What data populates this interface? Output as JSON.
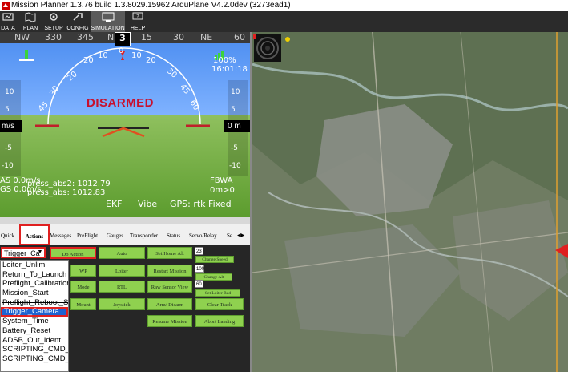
{
  "window": {
    "title": "Mission Planner 1.3.76 build 1.3.8029.15962 ArduPlane V4.2.0dev (3273ead1)"
  },
  "menubar": [
    {
      "label": "DATA",
      "icon": "data-icon"
    },
    {
      "label": "PLAN",
      "icon": "plan-icon"
    },
    {
      "label": "SETUP",
      "icon": "setup-icon"
    },
    {
      "label": "CONFIG",
      "icon": "config-icon"
    },
    {
      "label": "SIMULATION",
      "icon": "simulation-icon"
    },
    {
      "label": "HELP",
      "icon": "help-icon"
    }
  ],
  "hud": {
    "compass": [
      "NW",
      "330",
      "345",
      "N",
      "3",
      "15",
      "30",
      "NE",
      "60"
    ],
    "heading": "3",
    "roll_scale": [
      "20",
      "10",
      "0",
      "10",
      "20",
      "30",
      "30",
      "45",
      "45",
      "60",
      "60"
    ],
    "status": "DISARMED",
    "battery_percent": "100%",
    "clock": "16:01:18",
    "speed_readout": "m/s",
    "alt_readout": "0 m",
    "left_tape": [
      "10",
      "5",
      "0",
      "-5",
      "-10"
    ],
    "right_tape": [
      "10",
      "5",
      "0",
      "-5",
      "-10"
    ],
    "as_line": "AS 0.0m/s",
    "gs_line": "GS 0.0m/s",
    "press_abs2": "press_abs2: 1012.79",
    "press_abs": "press_abs: 1012.83",
    "mode": "FBWA",
    "alt_line": "0m>0",
    "ekf": "EKF",
    "vibe": "Vibe",
    "gps": "GPS: rtk Fixed"
  },
  "tabs": [
    "Quick",
    "Actions",
    "Messages",
    "PreFlight",
    "Gauges",
    "Transponder",
    "Status",
    "Servo/Relay",
    "Se"
  ],
  "actions": {
    "combo_value": "Trigger_Ca",
    "buttons": {
      "do_action": "Do Action",
      "auto": "Auto",
      "set_home_alt": "Set Home Alt",
      "wp": "WP",
      "loiter": "Loiter",
      "restart_mission": "Restart Mission",
      "mode": "Mode",
      "rtl": "RTL",
      "raw_sensor_view": "Raw Sensor View",
      "mount": "Mount",
      "joystick": "Joystick",
      "arm_disarm": "Arm/ Disarm",
      "clear_track": "Clear Track",
      "resume_mission": "Resume Mission",
      "abort_landing": "Abort Landing",
      "change_speed": "Change Speed",
      "change_alt": "Change Alt",
      "set_loiter_rad": "Set Loiter Rad"
    },
    "num_speed": "23",
    "num_alt": "100",
    "num_rad": "60"
  },
  "dropdown": [
    "Loiter_Unlim",
    "Return_To_Launch",
    "Preflight_Calibration",
    "Mission_Start",
    "Preflight_Reboot_Sh",
    "Trigger_Camera",
    "System_Time",
    "Battery_Reset",
    "ADSB_Out_Ident",
    "SCRIPTING_CMD_S",
    "SCRIPTING_CMD_S"
  ],
  "dropdown_selected": "Trigger_Camera",
  "colors": {
    "sky": "#6ea4f8",
    "ground": "#7cb346",
    "action_button": "#8fd14f",
    "highlight": "#e02020",
    "selection": "#1e63d1"
  }
}
